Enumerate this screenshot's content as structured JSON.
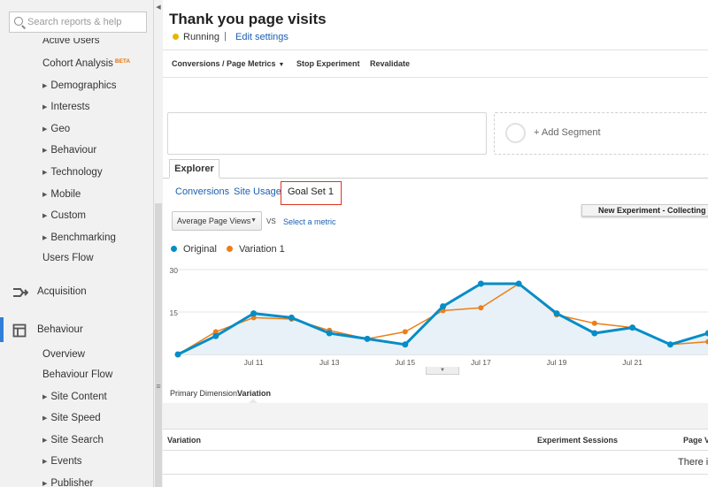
{
  "search": {
    "placeholder": "Search reports & help"
  },
  "sidebar": {
    "items": [
      {
        "label": "Active Users",
        "has_arrow": false
      },
      {
        "label": "Cohort Analysis",
        "badge": "BETA",
        "has_arrow": false
      },
      {
        "label": "Demographics",
        "has_arrow": true
      },
      {
        "label": "Interests",
        "has_arrow": true
      },
      {
        "label": "Geo",
        "has_arrow": true
      },
      {
        "label": "Behaviour",
        "has_arrow": true
      },
      {
        "label": "Technology",
        "has_arrow": true
      },
      {
        "label": "Mobile",
        "has_arrow": true
      },
      {
        "label": "Custom",
        "has_arrow": true
      },
      {
        "label": "Benchmarking",
        "has_arrow": true
      },
      {
        "label": "Users Flow",
        "has_arrow": false
      }
    ],
    "sections": [
      {
        "label": "Acquisition",
        "icon": "acquisition-arrows-icon"
      },
      {
        "label": "Behaviour",
        "icon": "behaviour-layout-icon",
        "active": true
      }
    ],
    "behaviour_items": [
      {
        "label": "Overview",
        "has_arrow": false
      },
      {
        "label": "Behaviour Flow",
        "has_arrow": false
      },
      {
        "label": "Site Content",
        "has_arrow": true
      },
      {
        "label": "Site Speed",
        "has_arrow": true
      },
      {
        "label": "Site Search",
        "has_arrow": true
      },
      {
        "label": "Events",
        "has_arrow": true
      },
      {
        "label": "Publisher",
        "has_arrow": true
      }
    ],
    "active_color": "#2f7ed8"
  },
  "header": {
    "title": "Thank you page visits",
    "status": "Running",
    "status_color": "#e5b700",
    "separator": "|",
    "edit_link": "Edit settings"
  },
  "toolbar": {
    "metrics_menu": "Conversions / Page Metrics",
    "stop": "Stop Experiment",
    "revalidate": "Revalidate"
  },
  "segments": {
    "add_label": "+ Add Segment"
  },
  "explorer": {
    "tab": "Explorer",
    "subtabs": [
      "Conversions",
      "Site Usage",
      "Goal Set 1"
    ],
    "active_subtab": "Goal Set 1",
    "highlight_color": "#e0341e"
  },
  "metric_picker": {
    "selected": "Average Page Views",
    "vs": "VS",
    "select_metric": "Select a metric"
  },
  "tooltip": "New Experiment - Collecting Data",
  "chart_data": {
    "type": "line",
    "series": [
      {
        "name": "Original",
        "color": "#058dc7",
        "values": [
          0,
          6.5,
          14.5,
          13,
          7.5,
          5.5,
          3.5,
          17,
          25,
          25,
          14.5,
          7.5,
          9.5,
          3.5,
          7.5
        ]
      },
      {
        "name": "Variation 1",
        "color": "#ed7e17",
        "values": [
          0,
          8,
          13,
          12.5,
          8.5,
          5.5,
          8,
          15.5,
          16.5,
          25,
          14,
          11,
          9.5,
          3.5,
          4.5
        ]
      }
    ],
    "x_ticks": [
      "Jul 11",
      "Jul 13",
      "Jul 15",
      "Jul 17",
      "Jul 19",
      "Jul 21"
    ],
    "y_ticks": [
      "30",
      "15"
    ],
    "ylim": [
      0,
      30
    ],
    "grid": true
  },
  "dimension": {
    "label": "Primary Dimension:",
    "value": "Variation"
  },
  "table": {
    "headers": [
      "Variation",
      "Experiment Sessions",
      "Page V"
    ],
    "empty_message": "There is"
  }
}
